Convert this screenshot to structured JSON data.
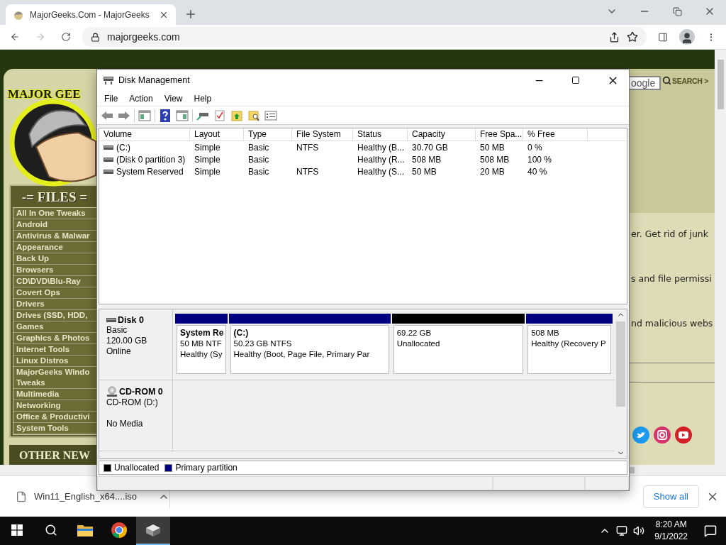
{
  "browser": {
    "tabs": [
      {
        "title": "MajorGeeks.Com - MajorGeeks",
        "selected": true
      }
    ],
    "address": "majorgeeks.com",
    "forward_disabled": true
  },
  "website": {
    "logo_text": "MAJOR GEE",
    "search": {
      "placeholder": "oogle",
      "button": "SEARCH >"
    },
    "files_heading": "-= FILES =",
    "categories": [
      "All In One Tweaks",
      "Android",
      "Antivirus & Malwar",
      "Appearance",
      "Back Up",
      "Browsers",
      "CD\\DVD\\Blu-Ray",
      "Covert Ops",
      "Drivers",
      "Drives (SSD, HDD,",
      "Games",
      "Graphics & Photos",
      "Internet Tools",
      "Linux Distros",
      "MajorGeeks Windo\nTweaks",
      "Multimedia",
      "Networking",
      "Office & Productivi",
      "System Tools"
    ],
    "other_heading": "OTHER NEW",
    "snippets": [
      "er. Get rid of junk",
      "s and file permissi",
      "nd malicious webs"
    ]
  },
  "disk_window": {
    "title": "Disk Management",
    "menu": [
      "File",
      "Action",
      "View",
      "Help"
    ],
    "columns": [
      "Volume",
      "Layout",
      "Type",
      "File System",
      "Status",
      "Capacity",
      "Free Spa...",
      "% Free"
    ],
    "volumes": [
      {
        "volume": "(C:)",
        "layout": "Simple",
        "type": "Basic",
        "file_system": "NTFS",
        "status": "Healthy (B...",
        "capacity": "30.70 GB",
        "free_space": "50 MB",
        "percent_free": "0 %"
      },
      {
        "volume": "(Disk 0 partition 3)",
        "layout": "Simple",
        "type": "Basic",
        "status": "Healthy (R...",
        "capacity": "508 MB",
        "free_space": "508 MB",
        "percent_free": "100 %"
      },
      {
        "volume": "System Reserved",
        "layout": "Simple",
        "type": "Basic",
        "file_system": "NTFS",
        "status": "Healthy (S...",
        "capacity": "50 MB",
        "free_space": "20 MB",
        "percent_free": "40 %"
      }
    ],
    "disks": [
      {
        "kind": "disk",
        "name": "Disk 0",
        "lines": [
          "Basic",
          "120.00 GB",
          "Online"
        ],
        "partitions": [
          {
            "kind": "primary",
            "name": "System Re",
            "size": "50 MB NTF",
            "status": "Healthy (Sy"
          },
          {
            "kind": "primary",
            "name": "(C:)",
            "size": "50.23 GB NTFS",
            "status": "Healthy (Boot, Page File, Primary Par"
          },
          {
            "kind": "unallocated",
            "size": "69.22 GB",
            "status": "Unallocated"
          },
          {
            "kind": "primary",
            "size": "508 MB",
            "status": "Healthy (Recovery P"
          }
        ]
      },
      {
        "kind": "cdrom",
        "name": "CD-ROM 0",
        "lines": [
          "CD-ROM (D:)",
          "No Media"
        ]
      }
    ],
    "legend": [
      {
        "label": "Unallocated",
        "color": "#000000"
      },
      {
        "label": "Primary partition",
        "color": "#000080"
      }
    ]
  },
  "downloads": {
    "file": "Win11_English_x64....iso",
    "show_all": "Show all"
  },
  "taskbar": {
    "apps": [
      {
        "kind": "folder",
        "selected": false
      },
      {
        "kind": "browser",
        "selected": false
      },
      {
        "kind": "drive",
        "selected": true
      }
    ],
    "time": "8:20 AM",
    "date": "9/1/2022"
  }
}
